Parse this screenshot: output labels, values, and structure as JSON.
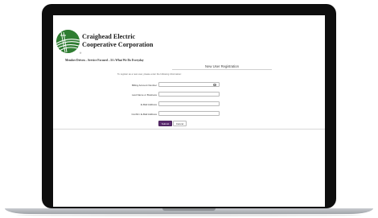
{
  "organization": {
    "name_line1": "Craighead Electric",
    "name_line2": "Cooperative Corporation",
    "registered_mark": "®",
    "tagline": "Member Driven – Service Focused – It's What We Do Everyday"
  },
  "form": {
    "title": "New User Registration",
    "instructions": "To register as a new user, please enter the following information:",
    "fields": [
      {
        "label": "Billing Account Number",
        "value": "",
        "has_help_icon": true
      },
      {
        "label": "Last Name or Business",
        "value": ""
      },
      {
        "label": "E-Mail Address",
        "value": ""
      },
      {
        "label": "Confirm E-Mail Address",
        "value": ""
      }
    ],
    "help_icon_glyph": "?",
    "submit_label": "Submit",
    "cancel_label": "Cancel"
  },
  "colors": {
    "brand_green": "#2f7d32",
    "submit_purple": "#5a2a6e",
    "bezel": "#0e0e0e"
  },
  "icons": {
    "logo": "power-lines-logo-icon",
    "help": "question-circle-icon"
  }
}
